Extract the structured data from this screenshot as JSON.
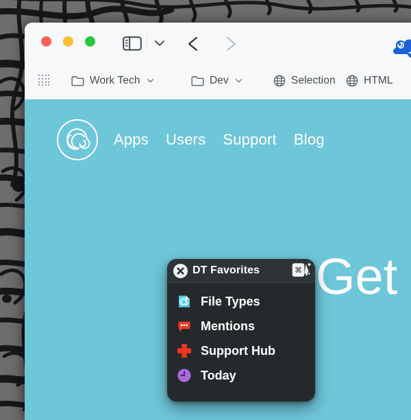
{
  "desktop": {
    "wallpaper_name": "abstract-lines-wallpaper",
    "base_color": "#6b6b6b",
    "line_color": "#17181a"
  },
  "window": {
    "titlebar": {
      "traffic_lights": [
        {
          "name": "close-window-button",
          "color": "#fa5f57"
        },
        {
          "name": "minimize-window-button",
          "color": "#f9bd2e"
        },
        {
          "name": "zoom-window-button",
          "color": "#28c840"
        }
      ],
      "sidebar_toggle_icon": "sidebar-icon",
      "sidebar_dropdown_icon": "chevron-down-icon",
      "back_icon": "chevron-left-icon",
      "forward_icon": "chevron-right-icon",
      "extension_icon": "cloud-extension-icon",
      "accent": "#1b62d8"
    },
    "toolbar": {
      "grid_icon": "apps-grid-icon",
      "items": [
        {
          "icon": "folder-icon",
          "label": "Work Tech",
          "has_dropdown": true
        },
        {
          "icon": "folder-icon",
          "label": "Dev",
          "has_dropdown": true
        },
        {
          "icon": "globe-icon",
          "label": "Selection",
          "has_dropdown": false
        },
        {
          "icon": "globe-icon",
          "label": "HTML",
          "has_dropdown": false
        }
      ]
    },
    "page": {
      "background": "#6ec6d9",
      "logo_icon": "spiral-shell-logo",
      "nav": [
        {
          "label": "Apps"
        },
        {
          "label": "Users"
        },
        {
          "label": "Support"
        },
        {
          "label": "Blog"
        }
      ],
      "hero_heading": "Get"
    }
  },
  "popup": {
    "title": "DT Favorites",
    "close_icon": "close-circle-icon",
    "shortcut_icon": "command-shortcut-icon",
    "shortcut_glyph": "⌘",
    "background": "#26292b",
    "items": [
      {
        "label": "File Types",
        "icon": "file-types-icon",
        "color": "#4ec8e6"
      },
      {
        "label": "Mentions",
        "icon": "mentions-bubble-icon",
        "color": "#ef3b25"
      },
      {
        "label": "Support Hub",
        "icon": "support-cross-icon",
        "color": "#ed3523"
      },
      {
        "label": "Today",
        "icon": "clock-icon",
        "color": "#a96ae0"
      }
    ]
  }
}
